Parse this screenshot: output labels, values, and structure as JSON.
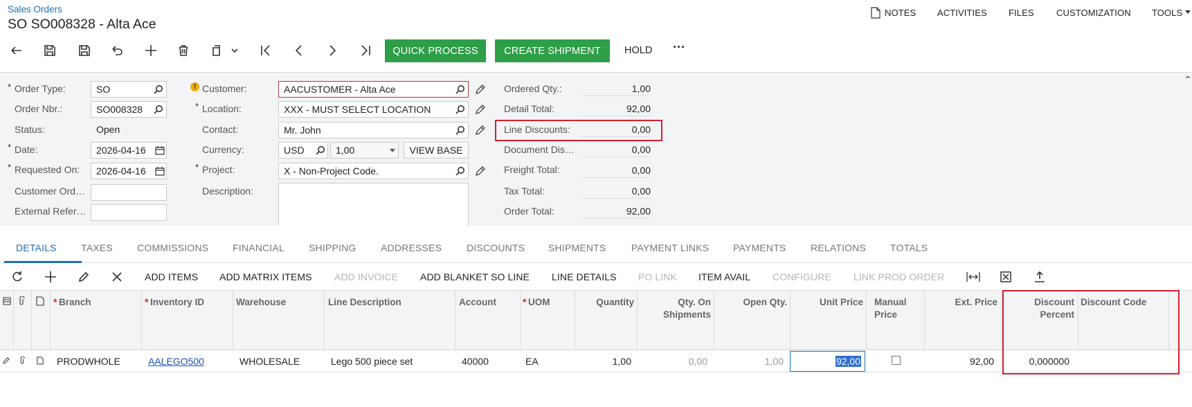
{
  "header": {
    "breadcrumb": "Sales Orders",
    "title": "SO SO008328 - Alta Ace",
    "links": {
      "notes": "NOTES",
      "activities": "ACTIVITIES",
      "files": "FILES",
      "customization": "CUSTOMIZATION",
      "tools": "TOOLS"
    }
  },
  "toolbar": {
    "quick_process": "QUICK PROCESS",
    "create_shipment": "CREATE SHIPMENT",
    "hold": "HOLD",
    "more": "···"
  },
  "form": {
    "order_type": {
      "label": "Order Type:",
      "value": "SO"
    },
    "order_nbr": {
      "label": "Order Nbr.:",
      "value": "SO008328"
    },
    "status": {
      "label": "Status:",
      "value": "Open"
    },
    "date": {
      "label": "Date:",
      "value": "2026-04-16"
    },
    "requested_on": {
      "label": "Requested On:",
      "value": "2026-04-16"
    },
    "customer_ord": {
      "label": "Customer Ord…",
      "value": ""
    },
    "external_ref": {
      "label": "External Refer…",
      "value": ""
    },
    "customer": {
      "label": "Customer:",
      "value": "AACUSTOMER - Alta Ace"
    },
    "location": {
      "label": "Location:",
      "value": "XXX - MUST SELECT LOCATION"
    },
    "contact": {
      "label": "Contact:",
      "value": "Mr. John"
    },
    "currency": {
      "label": "Currency:",
      "value": "USD",
      "rate": "1,00",
      "view_base": "VIEW BASE"
    },
    "project": {
      "label": "Project:",
      "value": "X - Non-Project Code."
    },
    "description": {
      "label": "Description:",
      "value": ""
    }
  },
  "totals": [
    {
      "label": "Ordered Qty.:",
      "value": "1,00"
    },
    {
      "label": "Detail Total:",
      "value": "92,00"
    },
    {
      "label": "Line Discounts:",
      "value": "0,00"
    },
    {
      "label": "Document Dis…",
      "value": "0,00"
    },
    {
      "label": "Freight Total:",
      "value": "0,00"
    },
    {
      "label": "Tax Total:",
      "value": "0,00"
    },
    {
      "label": "Order Total:",
      "value": "92,00"
    }
  ],
  "tabs": [
    "DETAILS",
    "TAXES",
    "COMMISSIONS",
    "FINANCIAL",
    "SHIPPING",
    "ADDRESSES",
    "DISCOUNTS",
    "SHIPMENTS",
    "PAYMENT LINKS",
    "PAYMENTS",
    "RELATIONS",
    "TOTALS"
  ],
  "grid_toolbar": {
    "add_items": "ADD ITEMS",
    "add_matrix_items": "ADD MATRIX ITEMS",
    "add_invoice": "ADD INVOICE",
    "add_blanket": "ADD BLANKET SO LINE",
    "line_details": "LINE DETAILS",
    "po_link": "PO LINK",
    "item_avail": "ITEM AVAIL",
    "configure": "CONFIGURE",
    "link_prod_order": "LINK PROD ORDER"
  },
  "grid": {
    "headers": {
      "branch": "Branch",
      "inventory_id": "Inventory ID",
      "warehouse": "Warehouse",
      "line_description": "Line Description",
      "account": "Account",
      "uom": "UOM",
      "quantity": "Quantity",
      "qty_on_shipments_1": "Qty. On",
      "qty_on_shipments_2": "Shipments",
      "open_qty": "Open Qty.",
      "unit_price": "Unit Price",
      "manual_price_1": "Manual",
      "manual_price_2": "Price",
      "ext_price": "Ext. Price",
      "discount_percent_1": "Discount",
      "discount_percent_2": "Percent",
      "discount_code": "Discount Code"
    },
    "row": {
      "branch": "PRODWHOLE",
      "inventory_id": "AALEGO500",
      "warehouse": "WHOLESALE",
      "line_description": "Lego 500 piece set",
      "account": "40000",
      "uom": "EA",
      "quantity": "1,00",
      "qty_on_shipments": "0,00",
      "open_qty": "1,00",
      "unit_price": "92,00",
      "manual_price": false,
      "ext_price": "92,00",
      "discount_percent": "0,000000",
      "discount_code": ""
    }
  },
  "colors": {
    "accent": "#1f6fb5",
    "primary_button": "#2e9e48",
    "highlight": "#d6202b"
  }
}
